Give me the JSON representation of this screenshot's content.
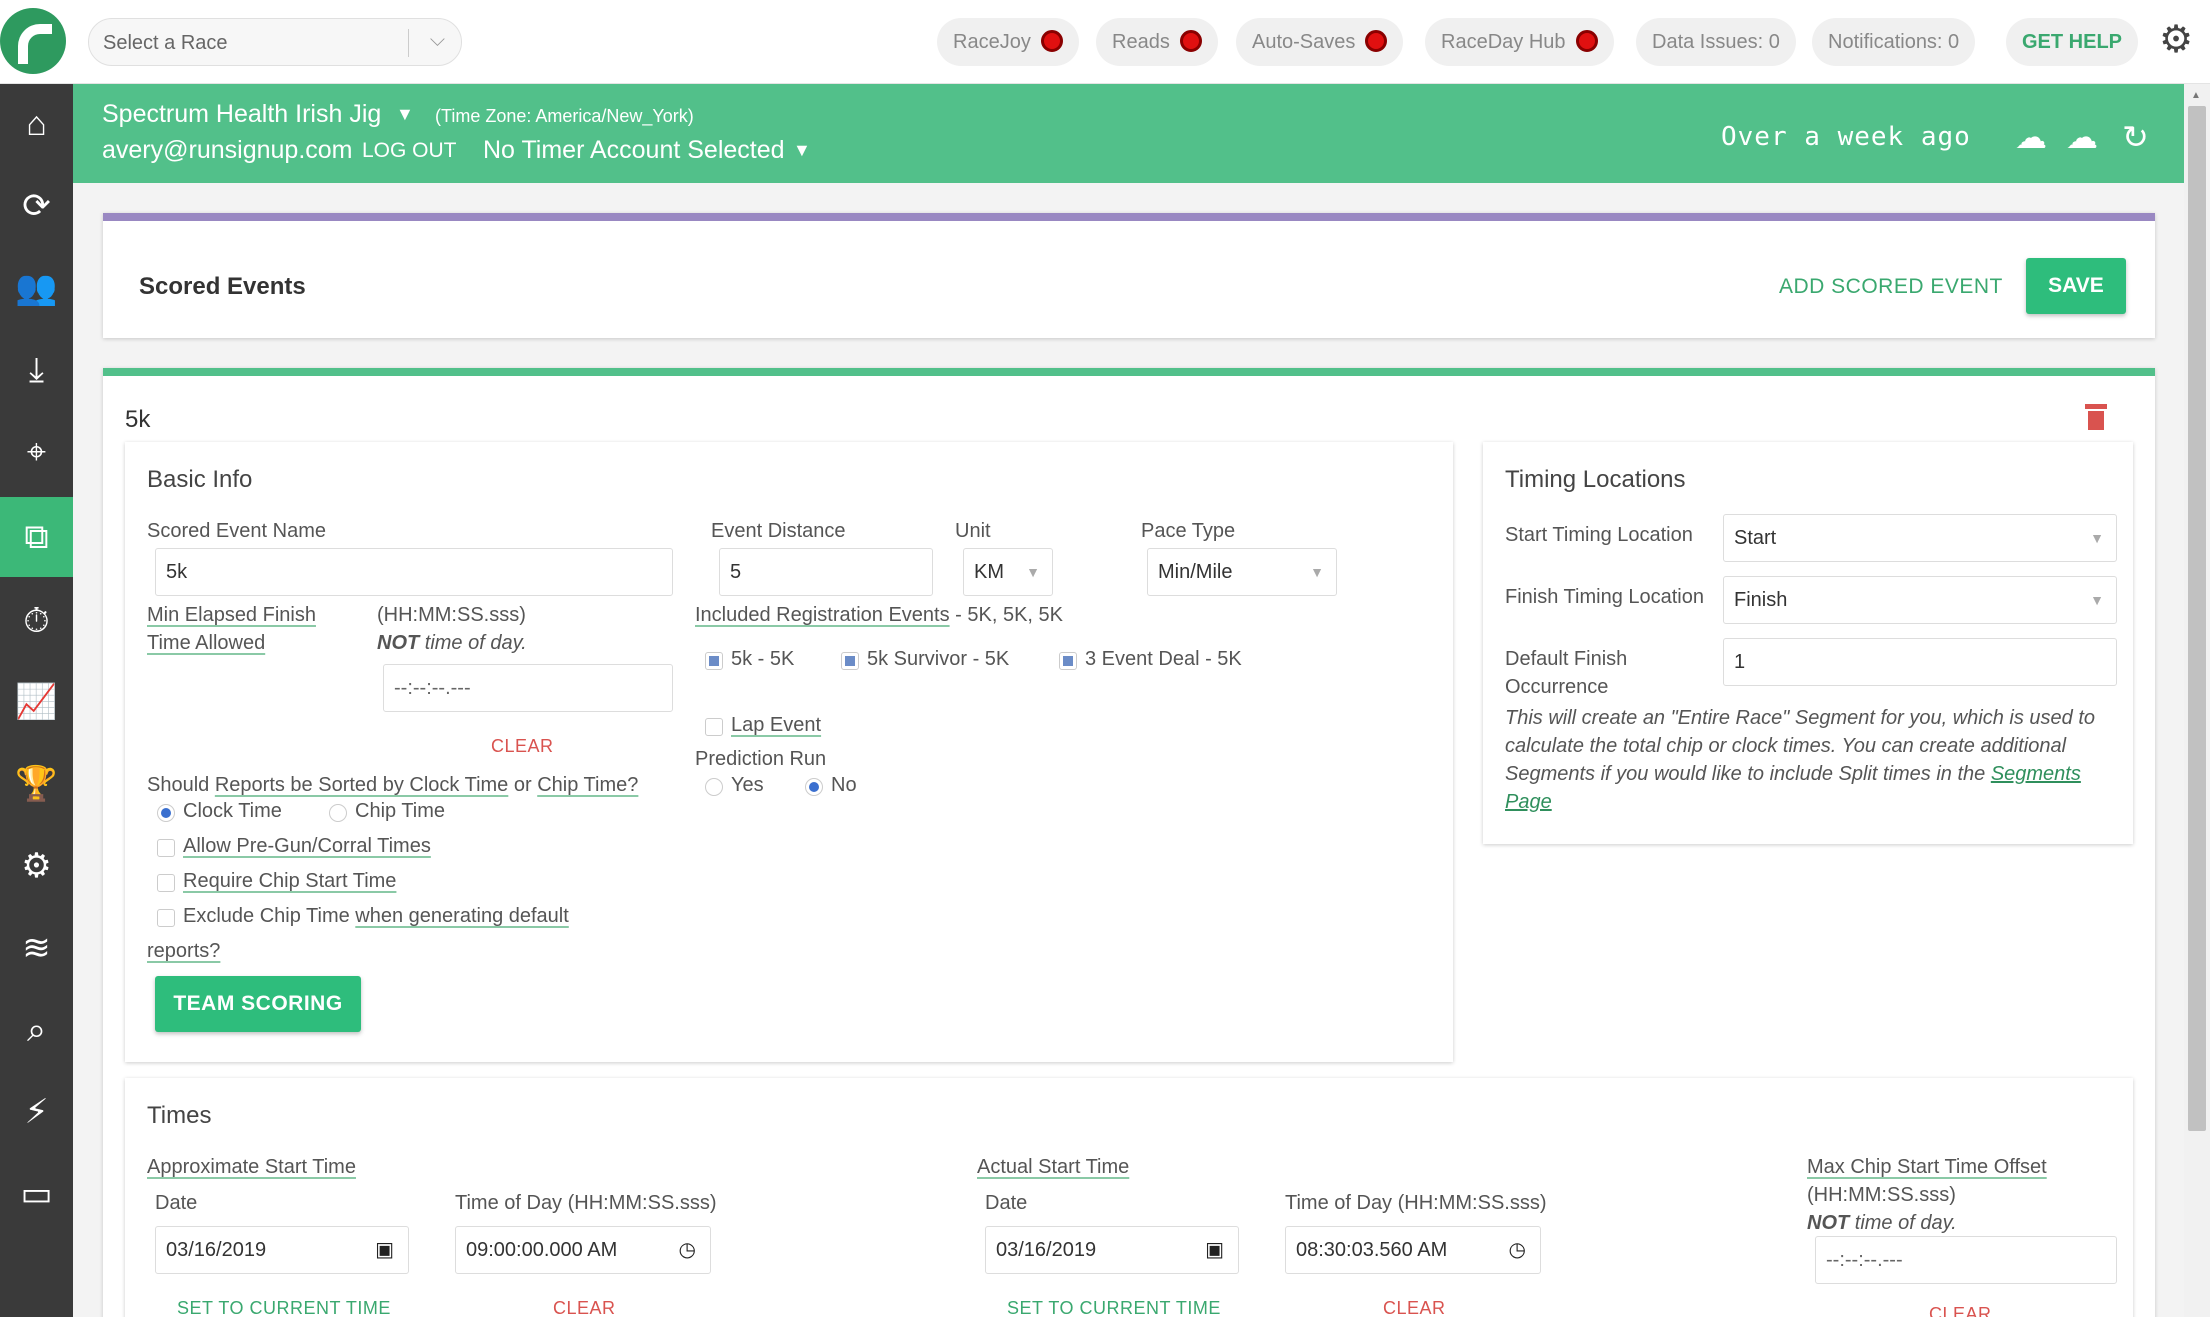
{
  "topbar": {
    "race_select_placeholder": "Select a Race",
    "pills": {
      "racejoy": "RaceJoy",
      "reads": "Reads",
      "autosaves": "Auto-Saves",
      "racedayhub": "RaceDay Hub",
      "data_issues": "Data Issues: 0",
      "notifications": "Notifications: 0",
      "help": "GET HELP"
    },
    "status_color": "#e01010"
  },
  "header": {
    "race_name": "Spectrum Health Irish Jig",
    "timezone": "(Time Zone: America/New_York)",
    "email": "avery@runsignup.com",
    "logout": "LOG OUT",
    "timer_account": "No Timer Account Selected",
    "last_sync": "Over a week ago",
    "accent": "#52c08a"
  },
  "scored_events": {
    "title": "Scored Events",
    "add_label": "ADD SCORED EVENT",
    "save_label": "SAVE"
  },
  "event": {
    "title": "5k",
    "basic": {
      "heading": "Basic Info",
      "name_label": "Scored Event Name",
      "name_value": "5k",
      "distance_label": "Event Distance",
      "distance_value": "5",
      "unit_label": "Unit",
      "unit_value": "KM",
      "pace_label": "Pace Type",
      "pace_value": "Min/Mile",
      "min_elapsed_line1": "Min Elapsed Finish",
      "min_elapsed_line2": "Time Allowed",
      "format_hint": "(HH:MM:SS.sss)",
      "not_label": "NOT",
      "time_of_day": " time of day.",
      "min_elapsed_placeholder": "--:--:--.---",
      "clear": "CLEAR",
      "included_label": "Included Registration Events",
      "included_list": " - 5K, 5K, 5K",
      "reg_events": [
        "5k - 5K",
        "5k Survivor - 5K",
        "3 Event Deal - 5K"
      ],
      "lap_event": "Lap Event",
      "prediction_label": "Prediction Run",
      "yes": "Yes",
      "no": "No",
      "sort_q_a": "Should ",
      "sort_q_b": "Reports be Sorted by Clock Time",
      "sort_q_c": " or ",
      "sort_q_d": "Chip Time?",
      "clock_time": "Clock Time",
      "chip_time": "Chip Time",
      "allow_pregun": "Allow Pre-Gun/Corral Times",
      "require_chip": "Require Chip Start Time",
      "exclude_a": "Exclude Chip Time ",
      "exclude_b": "when generating default",
      "exclude_c": "reports?",
      "team_scoring": "TEAM SCORING"
    },
    "timing": {
      "heading": "Timing Locations",
      "start_label": "Start Timing Location",
      "start_value": "Start",
      "finish_label": "Finish Timing Location",
      "finish_value": "Finish",
      "occ_label_1": "Default Finish",
      "occ_label_2": "Occurrence",
      "occ_value": "1",
      "note_line1": "This will create an \"Entire Race\" Segment for you, which is used to",
      "note_line2": "calculate the total chip or clock times. You can create additional",
      "note_line3a": "Segments if you would like to include Split times in the ",
      "note_link1": "Segments",
      "note_link2": "Page"
    },
    "times": {
      "heading": "Times",
      "approx_label": "Approximate Start Time",
      "actual_label": "Actual Start Time",
      "date_label": "Date",
      "tod_label": "Time of Day (HH:MM:SS.sss)",
      "approx_date": "03/16/2019",
      "approx_time": "09:00:00.000 AM",
      "actual_date": "03/16/2019",
      "actual_time": "08:30:03.560 AM",
      "set_current": "SET TO CURRENT TIME",
      "clear": "CLEAR",
      "max_chip_label": "Max Chip Start Time Offset",
      "max_chip_format": "(HH:MM:SS.sss)",
      "max_chip_placeholder": "--:--:--.---"
    }
  }
}
